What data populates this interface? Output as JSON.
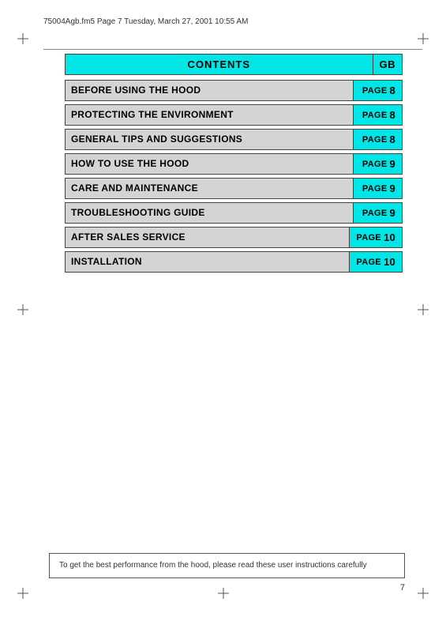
{
  "header": {
    "file_info": "75004Agb.fm5  Page 7  Tuesday, March 27, 2001  10:55 AM"
  },
  "contents": {
    "title": "CONTENTS",
    "gb_label": "GB",
    "items": [
      {
        "label": "BEFORE USING THE HOOD",
        "page_text": "PAGE",
        "page_num": "8"
      },
      {
        "label": "PROTECTING THE ENVIRONMENT",
        "page_text": "PAGE",
        "page_num": "8"
      },
      {
        "label": "GENERAL TIPS AND SUGGESTIONS",
        "page_text": "PAGE",
        "page_num": "8"
      },
      {
        "label": "HOW TO USE THE HOOD",
        "page_text": "PAGE",
        "page_num": "9"
      },
      {
        "label": "CARE AND MAINTENANCE",
        "page_text": "PAGE",
        "page_num": "9"
      },
      {
        "label": "TROUBLESHOOTING GUIDE",
        "page_text": "PAGE",
        "page_num": "9"
      },
      {
        "label": "AFTER SALES SERVICE",
        "page_text": "PAGE",
        "page_num": "10"
      },
      {
        "label": "INSTALLATION",
        "page_text": "PAGE",
        "page_num": "10"
      }
    ]
  },
  "bottom_note": {
    "text": "To get the best performance from the hood, please read these user instructions carefully"
  },
  "page_number": "7"
}
